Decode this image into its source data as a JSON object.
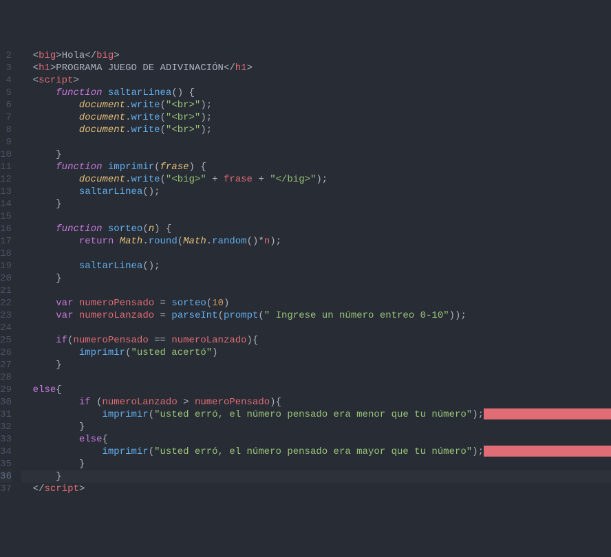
{
  "lines": [
    {
      "n": 2,
      "tokens": [
        [
          "  ",
          "c-plain"
        ],
        [
          "<",
          "c-punc"
        ],
        [
          "big",
          "c-tag"
        ],
        [
          ">",
          "c-punc"
        ],
        [
          "Hola",
          "c-plain"
        ],
        [
          "</",
          "c-punc"
        ],
        [
          "big",
          "c-tag"
        ],
        [
          ">",
          "c-punc"
        ]
      ]
    },
    {
      "n": 3,
      "tokens": [
        [
          "  ",
          "c-plain"
        ],
        [
          "<",
          "c-punc"
        ],
        [
          "h1",
          "c-tag"
        ],
        [
          ">",
          "c-punc"
        ],
        [
          "PROGRAMA JUEGO DE ADIVINACIÓN",
          "c-html"
        ],
        [
          "</",
          "c-punc"
        ],
        [
          "h1",
          "c-tag"
        ],
        [
          ">",
          "c-punc"
        ]
      ]
    },
    {
      "n": 4,
      "tokens": [
        [
          "  ",
          "c-plain"
        ],
        [
          "<",
          "c-punc"
        ],
        [
          "script",
          "c-tag"
        ],
        [
          ">",
          "c-punc"
        ]
      ]
    },
    {
      "n": 5,
      "tokens": [
        [
          "      ",
          "c-plain"
        ],
        [
          "function",
          "c-kw"
        ],
        [
          " ",
          "c-plain"
        ],
        [
          "saltarLinea",
          "c-fn"
        ],
        [
          "() {",
          "c-punc"
        ]
      ]
    },
    {
      "n": 6,
      "tokens": [
        [
          "          ",
          "c-plain"
        ],
        [
          "document",
          "c-obj"
        ],
        [
          ".",
          "c-punc"
        ],
        [
          "write",
          "c-fn"
        ],
        [
          "(",
          "c-punc"
        ],
        [
          "\"<br>\"",
          "c-str"
        ],
        [
          ");",
          "c-punc"
        ]
      ]
    },
    {
      "n": 7,
      "tokens": [
        [
          "          ",
          "c-plain"
        ],
        [
          "document",
          "c-obj"
        ],
        [
          ".",
          "c-punc"
        ],
        [
          "write",
          "c-fn"
        ],
        [
          "(",
          "c-punc"
        ],
        [
          "\"<br>\"",
          "c-str"
        ],
        [
          ");",
          "c-punc"
        ]
      ]
    },
    {
      "n": 8,
      "tokens": [
        [
          "          ",
          "c-plain"
        ],
        [
          "document",
          "c-obj"
        ],
        [
          ".",
          "c-punc"
        ],
        [
          "write",
          "c-fn"
        ],
        [
          "(",
          "c-punc"
        ],
        [
          "\"<br>\"",
          "c-str"
        ],
        [
          ");",
          "c-punc"
        ]
      ]
    },
    {
      "n": 9,
      "tokens": []
    },
    {
      "n": 10,
      "tokens": [
        [
          "      }",
          "c-punc"
        ]
      ]
    },
    {
      "n": 11,
      "tokens": [
        [
          "      ",
          "c-plain"
        ],
        [
          "function",
          "c-kw"
        ],
        [
          " ",
          "c-plain"
        ],
        [
          "imprimir",
          "c-fn"
        ],
        [
          "(",
          "c-punc"
        ],
        [
          "frase",
          "c-param"
        ],
        [
          ") {",
          "c-punc"
        ]
      ]
    },
    {
      "n": 12,
      "tokens": [
        [
          "          ",
          "c-plain"
        ],
        [
          "document",
          "c-obj"
        ],
        [
          ".",
          "c-punc"
        ],
        [
          "write",
          "c-fn"
        ],
        [
          "(",
          "c-punc"
        ],
        [
          "\"<big>\"",
          "c-str"
        ],
        [
          " + ",
          "c-punc"
        ],
        [
          "frase",
          "c-var"
        ],
        [
          " + ",
          "c-punc"
        ],
        [
          "\"</big>\"",
          "c-str"
        ],
        [
          ");",
          "c-punc"
        ]
      ]
    },
    {
      "n": 13,
      "tokens": [
        [
          "          ",
          "c-plain"
        ],
        [
          "saltarLinea",
          "c-fn"
        ],
        [
          "();",
          "c-punc"
        ]
      ]
    },
    {
      "n": 14,
      "tokens": [
        [
          "      }",
          "c-punc"
        ]
      ]
    },
    {
      "n": 15,
      "tokens": []
    },
    {
      "n": 16,
      "tokens": [
        [
          "      ",
          "c-plain"
        ],
        [
          "function",
          "c-kw"
        ],
        [
          " ",
          "c-plain"
        ],
        [
          "sorteo",
          "c-fn"
        ],
        [
          "(",
          "c-punc"
        ],
        [
          "n",
          "c-param"
        ],
        [
          ") {",
          "c-punc"
        ]
      ]
    },
    {
      "n": 17,
      "tokens": [
        [
          "          ",
          "c-plain"
        ],
        [
          "return",
          "c-kw2"
        ],
        [
          " ",
          "c-plain"
        ],
        [
          "Math",
          "c-obj"
        ],
        [
          ".",
          "c-punc"
        ],
        [
          "round",
          "c-fn"
        ],
        [
          "(",
          "c-punc"
        ],
        [
          "Math",
          "c-obj"
        ],
        [
          ".",
          "c-punc"
        ],
        [
          "random",
          "c-fn"
        ],
        [
          "()*",
          "c-punc"
        ],
        [
          "n",
          "c-var"
        ],
        [
          ");",
          "c-punc"
        ]
      ]
    },
    {
      "n": 18,
      "tokens": []
    },
    {
      "n": 19,
      "tokens": [
        [
          "          ",
          "c-plain"
        ],
        [
          "saltarLinea",
          "c-fn"
        ],
        [
          "();",
          "c-punc"
        ]
      ]
    },
    {
      "n": 20,
      "tokens": [
        [
          "      }",
          "c-punc"
        ]
      ]
    },
    {
      "n": 21,
      "tokens": []
    },
    {
      "n": 22,
      "tokens": [
        [
          "      ",
          "c-plain"
        ],
        [
          "var",
          "c-kw2"
        ],
        [
          " ",
          "c-plain"
        ],
        [
          "numeroPensado",
          "c-var"
        ],
        [
          " = ",
          "c-punc"
        ],
        [
          "sorteo",
          "c-fn"
        ],
        [
          "(",
          "c-punc"
        ],
        [
          "10",
          "c-num"
        ],
        [
          ")",
          "c-punc"
        ]
      ]
    },
    {
      "n": 23,
      "tokens": [
        [
          "      ",
          "c-plain"
        ],
        [
          "var",
          "c-kw2"
        ],
        [
          " ",
          "c-plain"
        ],
        [
          "numeroLanzado",
          "c-var"
        ],
        [
          " = ",
          "c-punc"
        ],
        [
          "parseInt",
          "c-fn"
        ],
        [
          "(",
          "c-punc"
        ],
        [
          "prompt",
          "c-fn"
        ],
        [
          "(",
          "c-punc"
        ],
        [
          "\" Ingrese un número entreo 0-10\"",
          "c-str"
        ],
        [
          "));",
          "c-punc"
        ]
      ]
    },
    {
      "n": 24,
      "tokens": []
    },
    {
      "n": 25,
      "tokens": [
        [
          "      ",
          "c-plain"
        ],
        [
          "if",
          "c-kw2"
        ],
        [
          "(",
          "c-punc"
        ],
        [
          "numeroPensado",
          "c-var"
        ],
        [
          " == ",
          "c-punc"
        ],
        [
          "numeroLanzado",
          "c-var"
        ],
        [
          "){",
          "c-punc"
        ]
      ]
    },
    {
      "n": 26,
      "tokens": [
        [
          "          ",
          "c-plain"
        ],
        [
          "imprimir",
          "c-fn"
        ],
        [
          "(",
          "c-punc"
        ],
        [
          "\"usted acertó\"",
          "c-str"
        ],
        [
          ")",
          "c-punc"
        ]
      ]
    },
    {
      "n": 27,
      "tokens": [
        [
          "      }",
          "c-punc"
        ]
      ]
    },
    {
      "n": 28,
      "tokens": []
    },
    {
      "n": 29,
      "tokens": [
        [
          "  ",
          "c-plain"
        ],
        [
          "else",
          "c-kw2"
        ],
        [
          "{",
          "c-punc"
        ]
      ]
    },
    {
      "n": 30,
      "tokens": [
        [
          "          ",
          "c-plain"
        ],
        [
          "if",
          "c-kw2"
        ],
        [
          " (",
          "c-punc"
        ],
        [
          "numeroLanzado",
          "c-var"
        ],
        [
          " > ",
          "c-punc"
        ],
        [
          "numeroPensado",
          "c-var"
        ],
        [
          "){",
          "c-punc"
        ]
      ]
    },
    {
      "n": 31,
      "tokens": [
        [
          "              ",
          "c-plain"
        ],
        [
          "imprimir",
          "c-fn"
        ],
        [
          "(",
          "c-punc"
        ],
        [
          "\"usted erró, el número pensado era menor que tu número\"",
          "c-str"
        ],
        [
          ");",
          "c-punc"
        ]
      ],
      "error": 185
    },
    {
      "n": 32,
      "tokens": [
        [
          "          }",
          "c-punc"
        ]
      ]
    },
    {
      "n": 33,
      "tokens": [
        [
          "          ",
          "c-plain"
        ],
        [
          "else",
          "c-kw2"
        ],
        [
          "{",
          "c-punc"
        ]
      ]
    },
    {
      "n": 34,
      "tokens": [
        [
          "              ",
          "c-plain"
        ],
        [
          "imprimir",
          "c-fn"
        ],
        [
          "(",
          "c-punc"
        ],
        [
          "\"usted erró, el número pensado era mayor que tu número\"",
          "c-str"
        ],
        [
          ");",
          "c-punc"
        ]
      ],
      "error": 185
    },
    {
      "n": 35,
      "tokens": [
        [
          "          }",
          "c-punc"
        ]
      ]
    },
    {
      "n": 36,
      "tokens": [
        [
          "      }",
          "c-punc"
        ]
      ],
      "highlight": true
    },
    {
      "n": 37,
      "tokens": [
        [
          "  ",
          "c-plain"
        ],
        [
          "</",
          "c-punc"
        ],
        [
          "script",
          "c-tag"
        ],
        [
          ">",
          "c-punc"
        ]
      ]
    }
  ]
}
